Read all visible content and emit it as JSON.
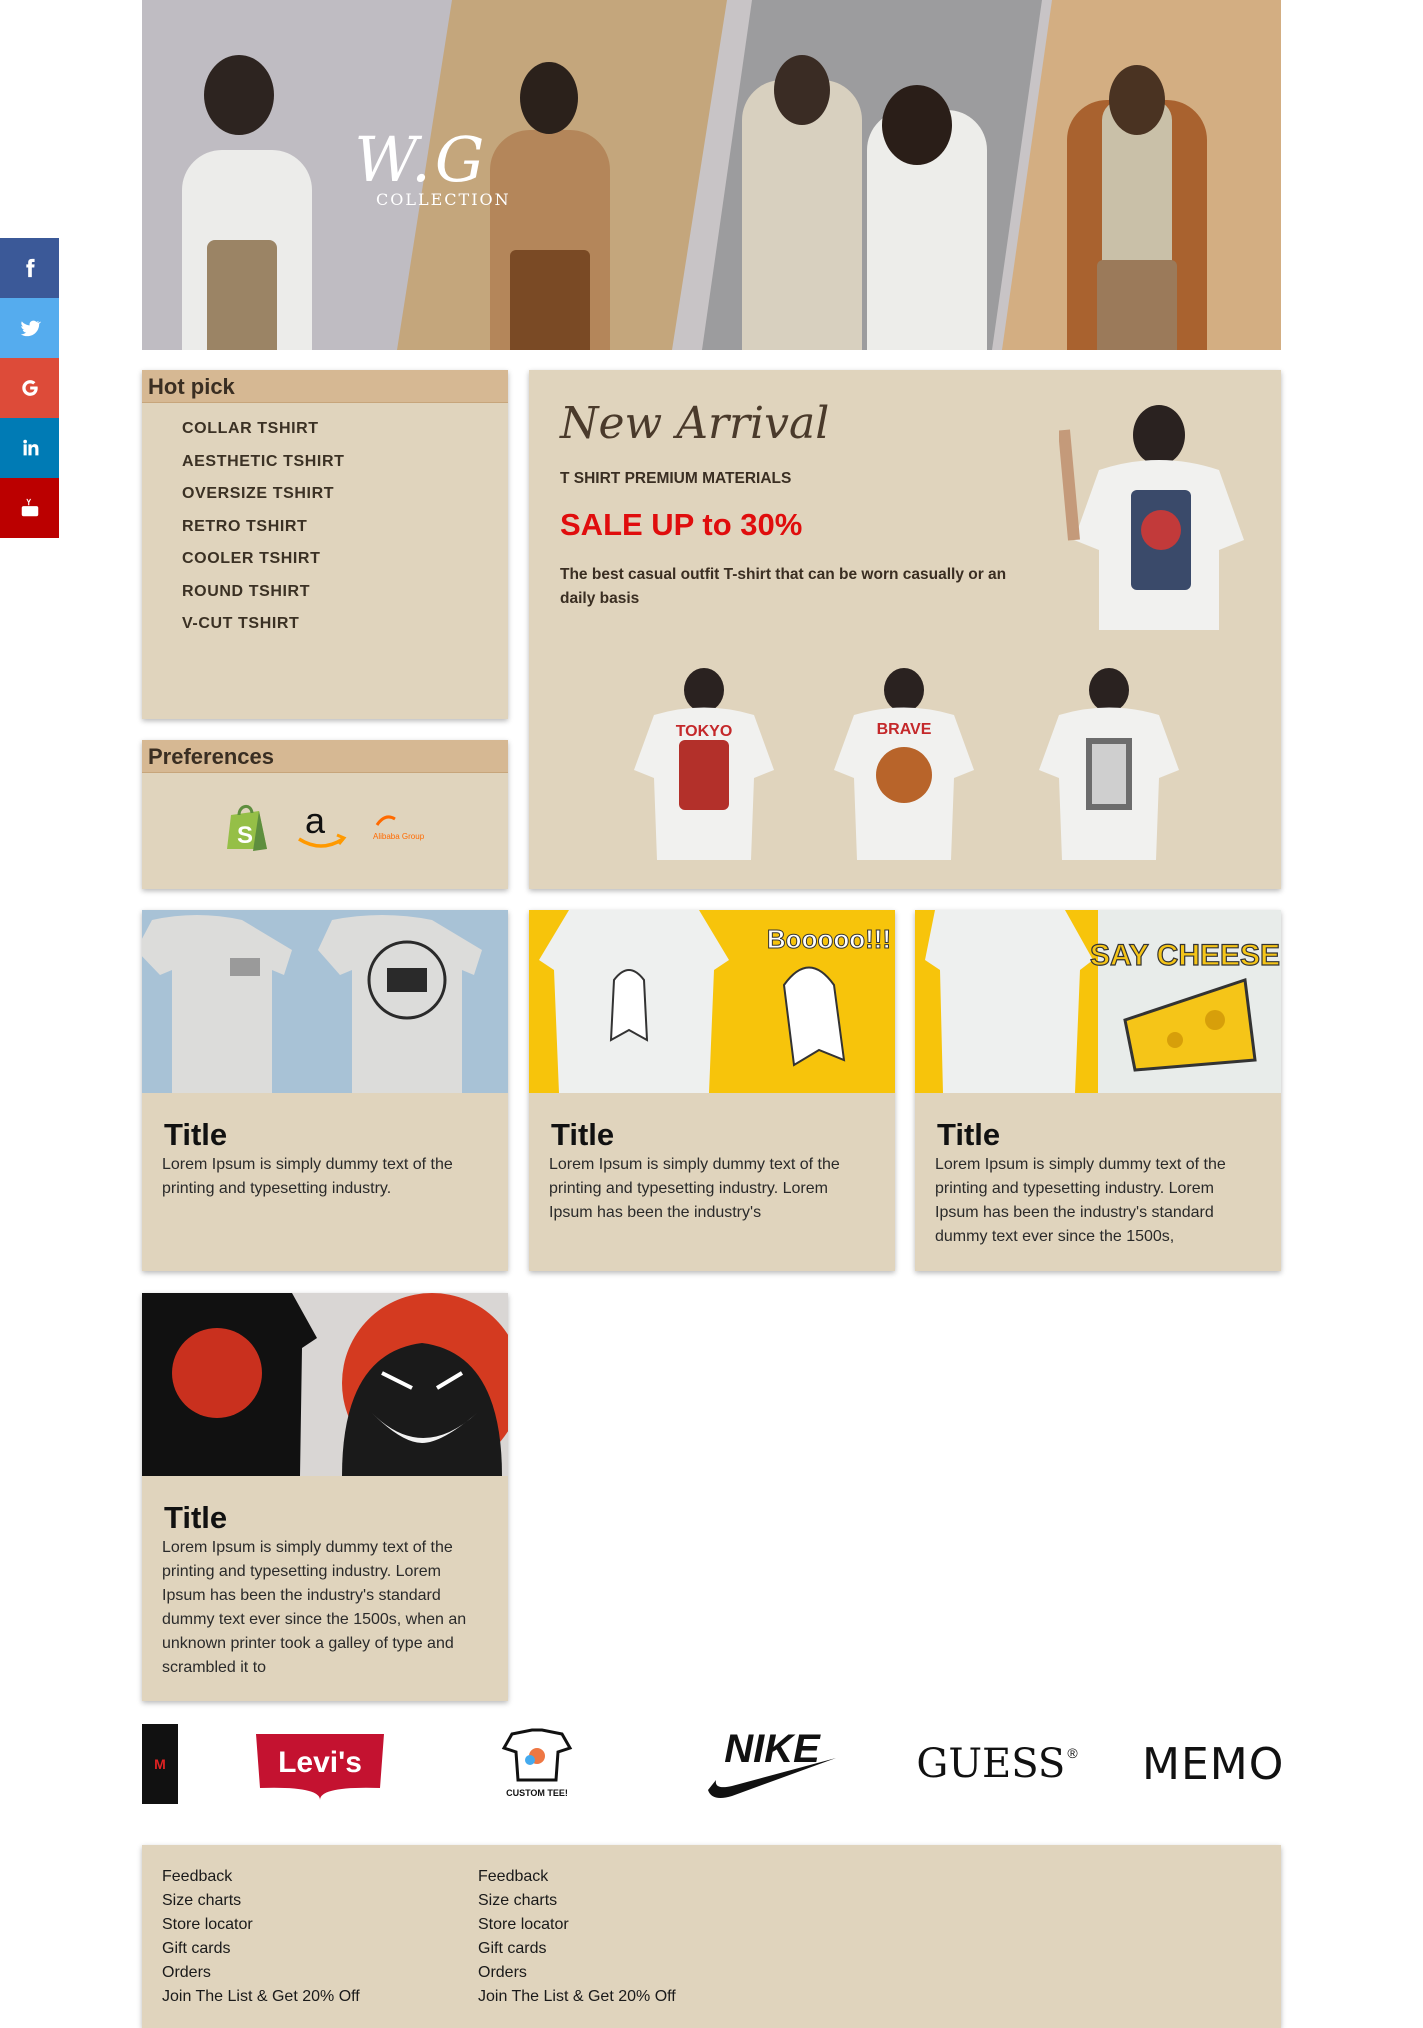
{
  "social": [
    {
      "name": "facebook",
      "icon": "facebook-icon",
      "color": "#3b5998"
    },
    {
      "name": "twitter",
      "icon": "twitter-icon",
      "color": "#55acee"
    },
    {
      "name": "google",
      "icon": "google-icon",
      "color": "#dd4b39"
    },
    {
      "name": "linkedin",
      "icon": "linkedin-icon",
      "color": "#007bb5"
    },
    {
      "name": "youtube",
      "icon": "youtube-icon",
      "color": "#bb0000"
    }
  ],
  "hero": {
    "logo_mark": "W.G",
    "logo_sub": "COLLECTION"
  },
  "hot_pick": {
    "title": "Hot pick",
    "items": [
      "COLLAR TSHIRT",
      "AESTHETIC TSHIRT",
      "OVERSIZE TSHIRT",
      "RETRO TSHIRT",
      "COOLER TSHIRT",
      "ROUND TSHIRT",
      "V-CUT TSHIRT"
    ]
  },
  "preferences": {
    "title": "Preferences",
    "logos": [
      "shopify-icon",
      "amazon-icon",
      "alibaba-icon"
    ],
    "alibaba_text": "Alibaba Group"
  },
  "new_arrival": {
    "title": "New Arrival",
    "subtitle": "T SHIRT PREMIUM MATERIALS",
    "sale": "SALE UP to 30%",
    "description": "The best casual outfit T-shirt that can be worn casually or an daily basis",
    "shirt_prints": [
      "TOKYO",
      "BRAVE",
      ""
    ]
  },
  "cards": [
    {
      "title": "Title",
      "text": "Lorem Ipsum is simply dummy text of the printing and typesetting industry.",
      "print": ""
    },
    {
      "title": "Title",
      "text": "Lorem Ipsum is simply dummy text of the printing and typesetting industry. Lorem Ipsum has been the industry's",
      "print": "Booooo!!!"
    },
    {
      "title": "Title",
      "text": "Lorem Ipsum is simply dummy text of the printing and typesetting industry. Lorem Ipsum has been the industry's standard dummy text ever since the 1500s,",
      "print": "SAY CHEESE!"
    },
    {
      "title": "Title",
      "text": "Lorem Ipsum is simply dummy text of the printing and typesetting industry. Lorem Ipsum has been the industry's standard dummy text ever since the 1500s, when an unknown printer took a galley of type and scrambled it to",
      "print": ""
    }
  ],
  "brands": [
    "M",
    "Levi's",
    "CUSTOM TEE!",
    "NIKE",
    "GUESS",
    "MEMO"
  ],
  "footer": {
    "col1": [
      "Feedback",
      "Size charts",
      "Store locator",
      "Gift cards",
      "Orders",
      "Join The List & Get 20% Off"
    ],
    "col2": [
      "Feedback",
      "Size charts",
      "Store locator",
      "Gift cards",
      "Orders",
      "Join The List & Get 20% Off"
    ]
  },
  "colors": {
    "panel": "#e0d4bd",
    "panel_header": "#d6b893",
    "sale": "#e00d0d"
  }
}
